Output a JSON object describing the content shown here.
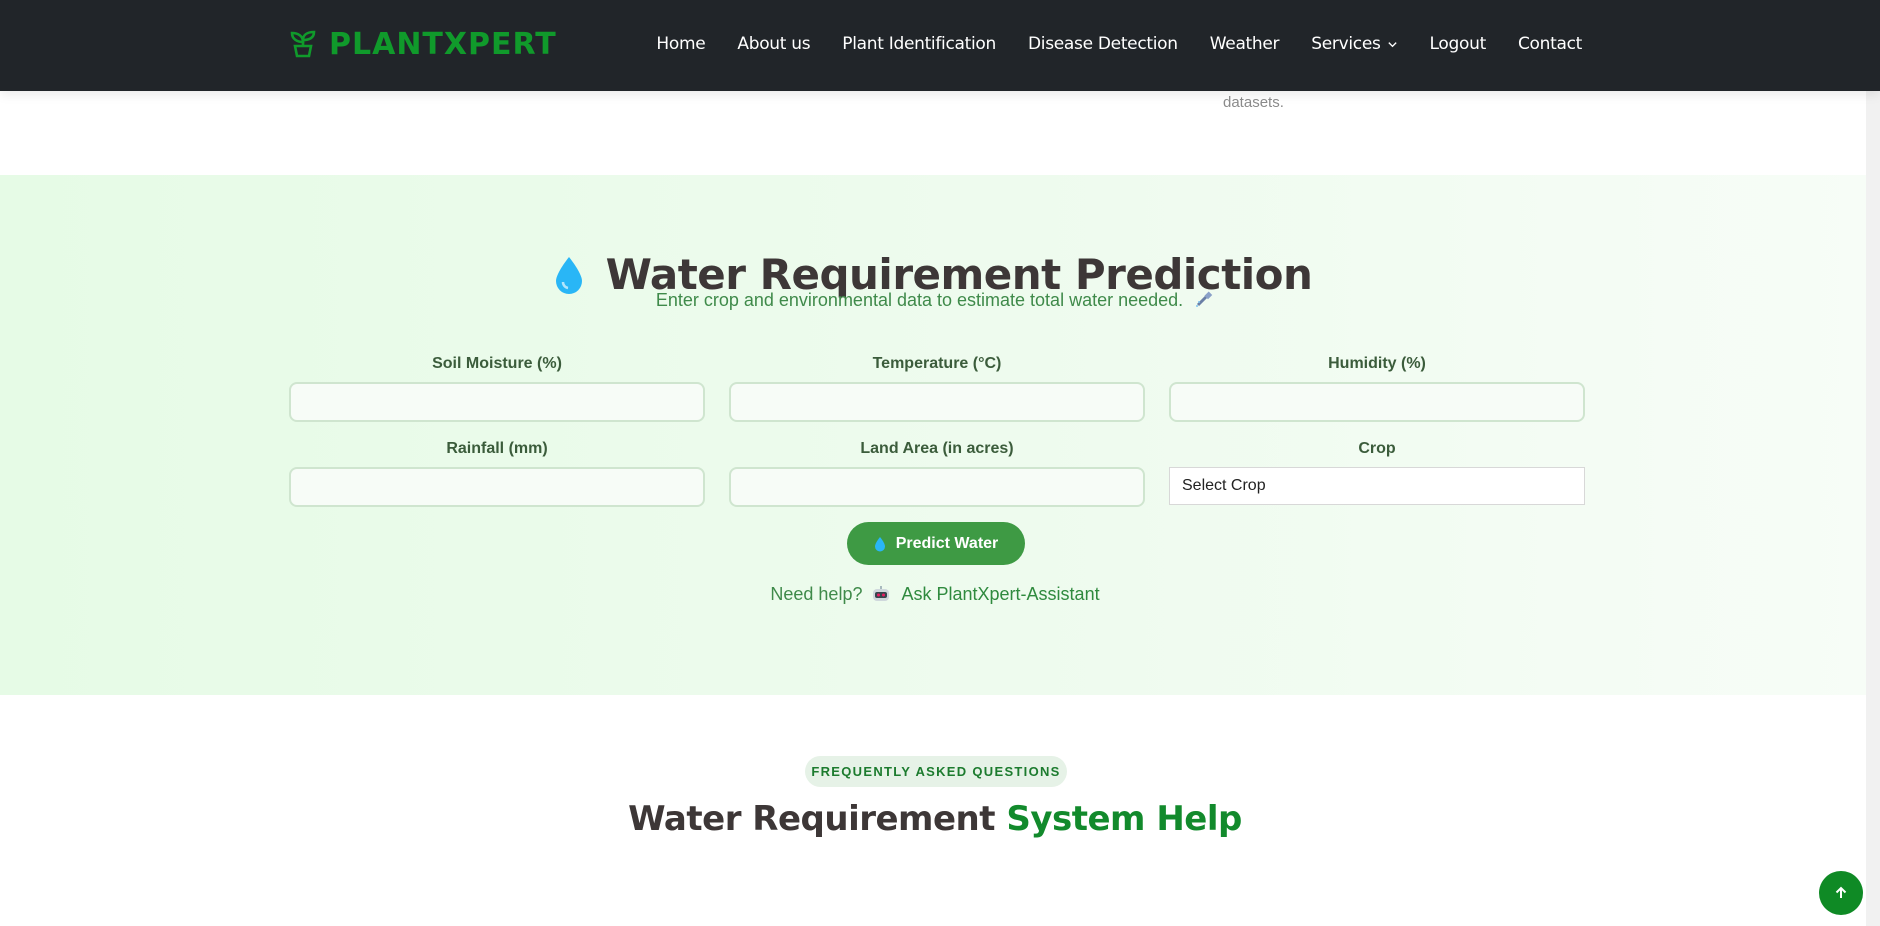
{
  "brand": {
    "name": "PLANTXPERT",
    "icon": "sprout-icon"
  },
  "nav": {
    "items": [
      "Home",
      "About us",
      "Plant Identification",
      "Disease Detection",
      "Weather",
      "Services",
      "Logout",
      "Contact"
    ]
  },
  "trail_text": "datasets.",
  "section": {
    "icon": "water-drop-icon",
    "title": "Water Requirement Prediction",
    "subtitle": "Enter crop and environmental data to estimate total water needed.",
    "subtitle_icon": "hose-icon",
    "fields": {
      "soil_moisture": {
        "label": "Soil Moisture (%)",
        "value": ""
      },
      "temperature": {
        "label": "Temperature (°C)",
        "value": ""
      },
      "humidity": {
        "label": "Humidity (%)",
        "value": ""
      },
      "rainfall": {
        "label": "Rainfall (mm)",
        "value": ""
      },
      "land_area": {
        "label": "Land Area (in acres)",
        "value": ""
      },
      "crop": {
        "label": "Crop",
        "selected": "Select Crop"
      }
    },
    "button": "Predict Water",
    "help_prefix": "Need help?",
    "help_link": "Ask PlantXpert-Assistant"
  },
  "faq": {
    "badge": "FREQUENTLY ASKED QUESTIONS",
    "title_part1": "Water Requirement",
    "title_part2": "System Help"
  },
  "colors": {
    "nav_bg": "#212529",
    "brand_green": "#109a2b",
    "button_green": "#3e9a44",
    "section_bg": "#e6fbe6"
  }
}
